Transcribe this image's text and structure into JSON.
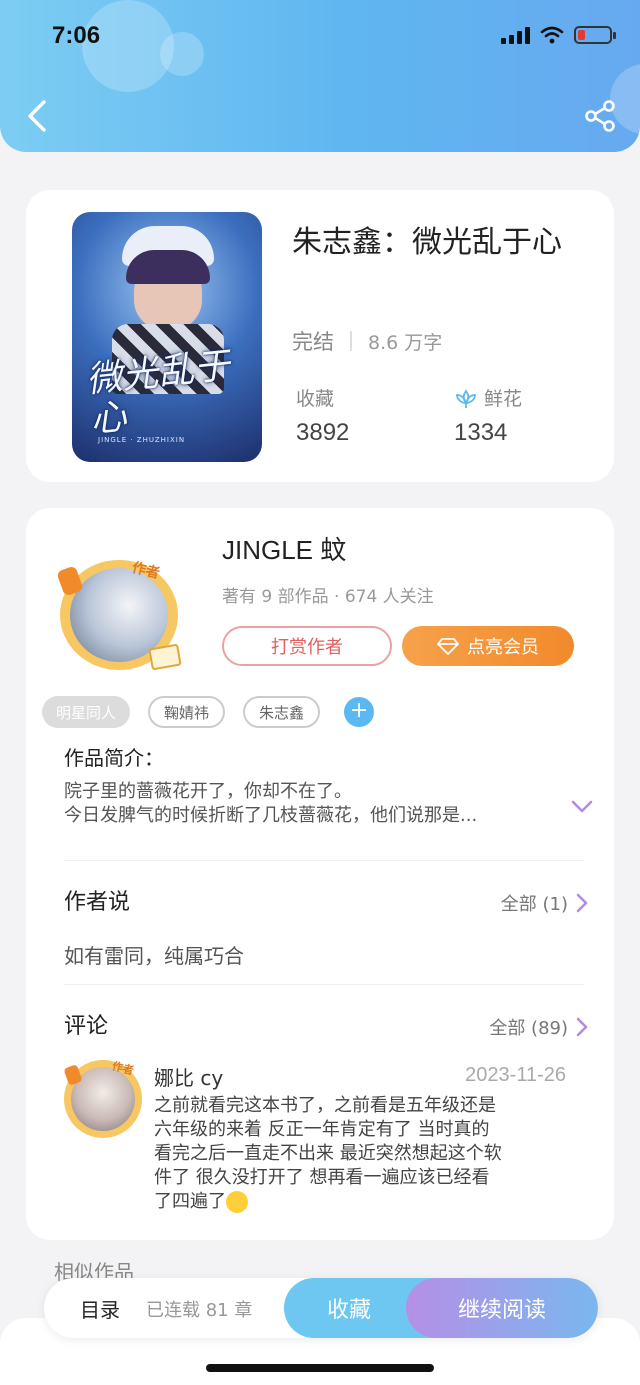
{
  "status_bar": {
    "time": "7:06"
  },
  "book": {
    "title": "朱志鑫：微光乱于心",
    "cover_title": "微光乱于心",
    "cover_subtitle": "JINGLE · ZHUZHIXIN",
    "status": "完结",
    "word_count": "8.6 万字",
    "favorites_label": "收藏",
    "favorites_value": "3892",
    "flowers_label": "鲜花",
    "flowers_value": "1334"
  },
  "author": {
    "name": "JINGLE 蚊",
    "avatar_badge": "作者",
    "stats": "著有 9 部作品 · 674 人关注",
    "tip_button": "打赏作者",
    "vip_button": "点亮会员"
  },
  "tags": [
    "明星同人",
    "鞠婧祎",
    "朱志鑫"
  ],
  "intro": {
    "title": "作品简介：",
    "lines": [
      "院子里的蔷薇花开了，你却不在了。",
      "今日发脾气的时候折断了几枝蔷薇花，他们说那是..."
    ]
  },
  "author_says": {
    "title": "作者说",
    "more": "全部 (1)",
    "text": "如有雷同，纯属巧合"
  },
  "comments": {
    "title": "评论",
    "more": "全部 (89)",
    "item": {
      "avatar_badge": "作者",
      "user": "娜比 cy",
      "date": "2023-11-26",
      "lines": [
        "之前就看完这本书了，之前看是五年级还是",
        "六年级的来着  反正一年肯定有了  当时真的",
        "看完之后一直走不出来  最近突然想起这个软",
        "件了  很久没打开了   想再看一遍应该已经看",
        "了四遍了"
      ]
    }
  },
  "similar": {
    "title": "相似作品"
  },
  "bottom_bar": {
    "toc": "目录",
    "serial": "已连载 81 章",
    "collect": "收藏",
    "read": "继续阅读"
  },
  "colors": {
    "header_blue": "#5fb6f0",
    "vip_orange": "#f18a2c",
    "tip_red": "#e36060",
    "read_purple": "#b58fe6"
  }
}
